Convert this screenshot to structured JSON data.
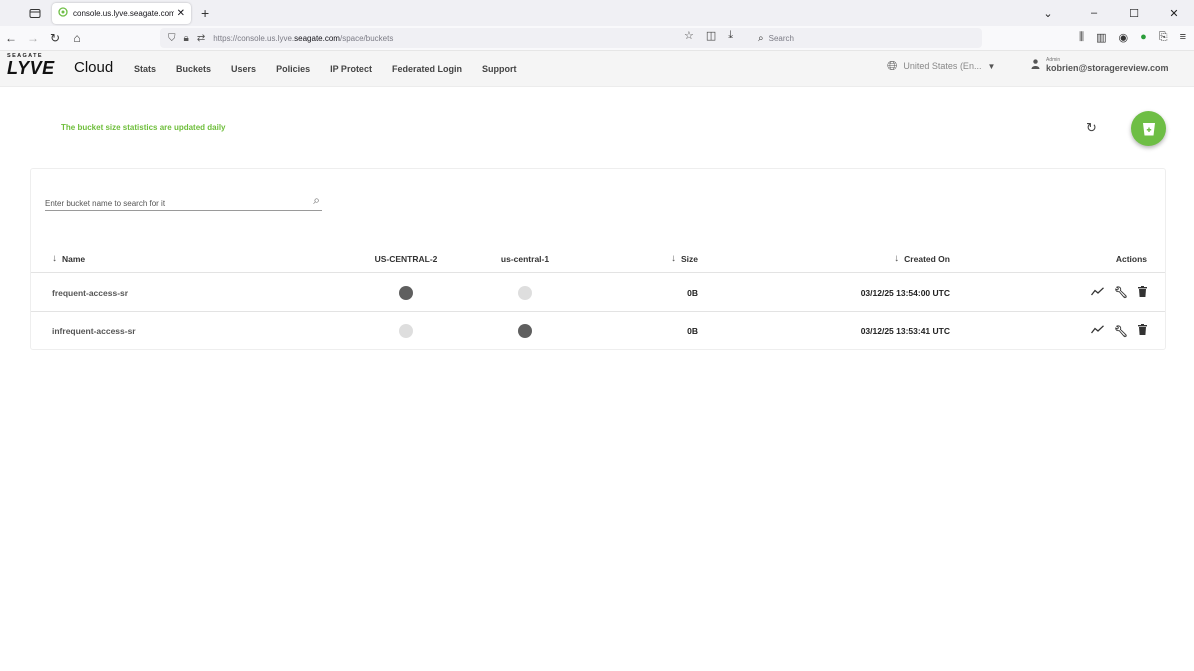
{
  "browser": {
    "tab_title": "console.us.lyve.seagate.com/sp",
    "url_prefix": "https://console.us.lyve.",
    "url_domain": "seagate.com",
    "url_path": "/space/buckets",
    "search_placeholder": "Search"
  },
  "app": {
    "logo_brand": "SEAGATE",
    "logo_product": "LYVE",
    "logo_cloud": "Cloud",
    "nav": [
      "Stats",
      "Buckets",
      "Users",
      "Policies",
      "IP Protect",
      "Federated Login",
      "Support"
    ],
    "region": "United States (En...",
    "user_role": "Admin",
    "user_email": "kobrien@storagereview.com"
  },
  "content": {
    "info_text": "The bucket size statistics are updated daily",
    "search_placeholder": "Enter bucket name to search for it",
    "columns": {
      "name": "Name",
      "region1": "US-CENTRAL-2",
      "region2": "us-central-1",
      "size": "Size",
      "created": "Created On",
      "actions": "Actions"
    },
    "rows": [
      {
        "name": "frequent-access-sr",
        "region1_active": true,
        "region2_active": false,
        "size": "0B",
        "created": "03/12/25 13:54:00 UTC"
      },
      {
        "name": "infrequent-access-sr",
        "region1_active": false,
        "region2_active": true,
        "size": "0B",
        "created": "03/12/25 13:53:41 UTC"
      }
    ]
  },
  "colors": {
    "accent_green": "#6ebe45",
    "active_dot": "#5f5f5f",
    "inactive_dot": "#dedede"
  }
}
